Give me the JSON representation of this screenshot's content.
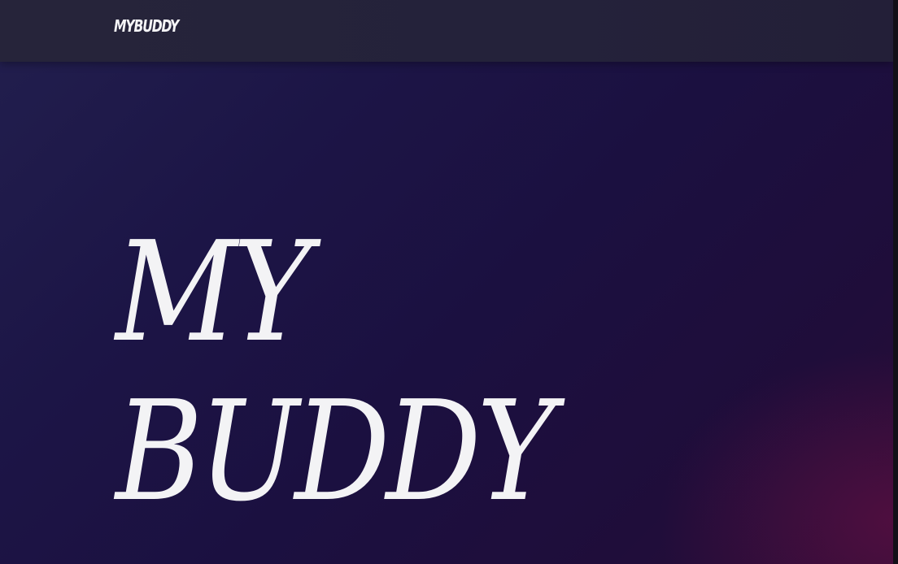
{
  "nav": {
    "brand": "MYBUDDY"
  },
  "hero": {
    "title_lines": [
      "MY",
      "BUDDY"
    ]
  },
  "colors": {
    "header_bg": "#26243a",
    "page_bg_start": "#221f4e",
    "page_bg_end": "#2b0c36",
    "text": "#f3f3f5"
  }
}
